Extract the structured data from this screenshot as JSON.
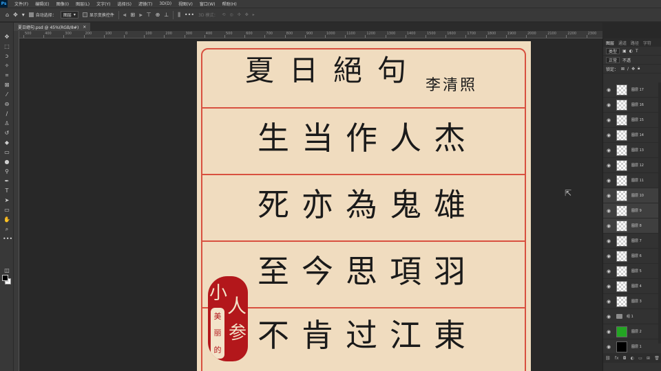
{
  "app": {
    "logo": "Ps",
    "menu": [
      "文件(F)",
      "编辑(E)",
      "图像(I)",
      "图层(L)",
      "文字(Y)",
      "选择(S)",
      "滤镜(T)",
      "3D(D)",
      "视图(V)",
      "窗口(W)",
      "帮助(H)"
    ]
  },
  "options": {
    "auto_select_label": "自动选择：",
    "auto_select_target": "图层",
    "transform_controls_label": "显示变换控件",
    "mode_3d_label": "3D 模式："
  },
  "document": {
    "tab_title": "夏日絕句.psd @ 45%(RGB/8#)",
    "close_glyph": "×"
  },
  "ruler": {
    "labels": [
      "500",
      "400",
      "300",
      "200",
      "100",
      "0",
      "100",
      "200",
      "300",
      "400",
      "500",
      "600",
      "700",
      "800",
      "900",
      "1000",
      "1100",
      "1200",
      "1300",
      "1400",
      "1500",
      "1600",
      "1700",
      "1800",
      "1900",
      "2000",
      "2100",
      "2200",
      "2300"
    ]
  },
  "artwork": {
    "title_chars": [
      "夏",
      "日",
      "絕",
      "句"
    ],
    "author": "李清照",
    "lines": [
      [
        "生",
        "当",
        "作",
        "人",
        "杰"
      ],
      [
        "死",
        "亦",
        "為",
        "鬼",
        "雄"
      ],
      [
        "至",
        "今",
        "思",
        "項",
        "羽"
      ],
      [
        "不",
        "肯",
        "过",
        "江",
        "東"
      ]
    ],
    "seal": {
      "big_chars": [
        "小",
        "人",
        "参"
      ],
      "strip_chars": [
        "美",
        "丽",
        "的"
      ]
    },
    "colors": {
      "paper": "#f0dcbf",
      "rule_red": "#d8503f",
      "seal_red": "#b3171b"
    }
  },
  "layers_panel": {
    "tabs": [
      "图层",
      "通道",
      "路径",
      "字符"
    ],
    "kind_filter": "类型",
    "blend_mode": "正常",
    "opacity_label": "不透",
    "lock_label": "锁定：",
    "layers": [
      {
        "name": "图层 17",
        "thumb": "transparent",
        "selected": false
      },
      {
        "name": "图层 16",
        "thumb": "transparent",
        "selected": false
      },
      {
        "name": "图层 15",
        "thumb": "transparent",
        "selected": false
      },
      {
        "name": "图层 14",
        "thumb": "transparent",
        "selected": false
      },
      {
        "name": "图层 13",
        "thumb": "transparent",
        "selected": false
      },
      {
        "name": "图层 12",
        "thumb": "transparent",
        "selected": false
      },
      {
        "name": "图层 11",
        "thumb": "transparent",
        "selected": false
      },
      {
        "name": "图层 10",
        "thumb": "transparent",
        "selected": true
      },
      {
        "name": "图层 9",
        "thumb": "transparent",
        "selected": true
      },
      {
        "name": "图层 8",
        "thumb": "transparent",
        "selected": true
      },
      {
        "name": "图层 7",
        "thumb": "transparent",
        "selected": false
      },
      {
        "name": "图层 6",
        "thumb": "transparent",
        "selected": false
      },
      {
        "name": "图层 5",
        "thumb": "transparent",
        "selected": false
      },
      {
        "name": "图层 4",
        "thumb": "transparent",
        "selected": false
      },
      {
        "name": "图层 3",
        "thumb": "transparent",
        "selected": false
      },
      {
        "name": "组 1",
        "thumb": "folder",
        "selected": false
      },
      {
        "name": "图层 2",
        "thumb": "green",
        "selected": false
      },
      {
        "name": "图层 1",
        "thumb": "black",
        "selected": false
      }
    ],
    "footer_icons": [
      "link-icon",
      "fx-icon",
      "mask-icon",
      "adjustment-icon",
      "folder-icon",
      "new-layer-icon",
      "trash-icon"
    ]
  }
}
